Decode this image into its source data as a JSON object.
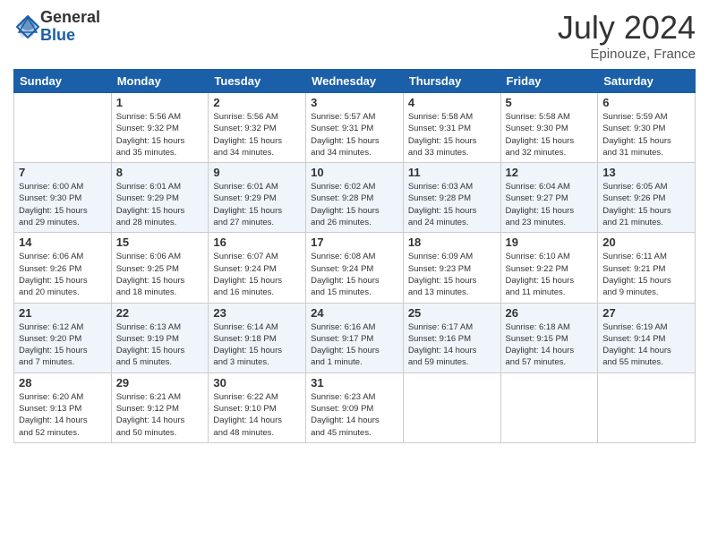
{
  "header": {
    "logo_general": "General",
    "logo_blue": "Blue",
    "month": "July 2024",
    "location": "Epinouze, France"
  },
  "weekdays": [
    "Sunday",
    "Monday",
    "Tuesday",
    "Wednesday",
    "Thursday",
    "Friday",
    "Saturday"
  ],
  "weeks": [
    [
      {
        "day": "",
        "info": ""
      },
      {
        "day": "1",
        "info": "Sunrise: 5:56 AM\nSunset: 9:32 PM\nDaylight: 15 hours\nand 35 minutes."
      },
      {
        "day": "2",
        "info": "Sunrise: 5:56 AM\nSunset: 9:32 PM\nDaylight: 15 hours\nand 34 minutes."
      },
      {
        "day": "3",
        "info": "Sunrise: 5:57 AM\nSunset: 9:31 PM\nDaylight: 15 hours\nand 34 minutes."
      },
      {
        "day": "4",
        "info": "Sunrise: 5:58 AM\nSunset: 9:31 PM\nDaylight: 15 hours\nand 33 minutes."
      },
      {
        "day": "5",
        "info": "Sunrise: 5:58 AM\nSunset: 9:30 PM\nDaylight: 15 hours\nand 32 minutes."
      },
      {
        "day": "6",
        "info": "Sunrise: 5:59 AM\nSunset: 9:30 PM\nDaylight: 15 hours\nand 31 minutes."
      }
    ],
    [
      {
        "day": "7",
        "info": "Sunrise: 6:00 AM\nSunset: 9:30 PM\nDaylight: 15 hours\nand 29 minutes."
      },
      {
        "day": "8",
        "info": "Sunrise: 6:01 AM\nSunset: 9:29 PM\nDaylight: 15 hours\nand 28 minutes."
      },
      {
        "day": "9",
        "info": "Sunrise: 6:01 AM\nSunset: 9:29 PM\nDaylight: 15 hours\nand 27 minutes."
      },
      {
        "day": "10",
        "info": "Sunrise: 6:02 AM\nSunset: 9:28 PM\nDaylight: 15 hours\nand 26 minutes."
      },
      {
        "day": "11",
        "info": "Sunrise: 6:03 AM\nSunset: 9:28 PM\nDaylight: 15 hours\nand 24 minutes."
      },
      {
        "day": "12",
        "info": "Sunrise: 6:04 AM\nSunset: 9:27 PM\nDaylight: 15 hours\nand 23 minutes."
      },
      {
        "day": "13",
        "info": "Sunrise: 6:05 AM\nSunset: 9:26 PM\nDaylight: 15 hours\nand 21 minutes."
      }
    ],
    [
      {
        "day": "14",
        "info": "Sunrise: 6:06 AM\nSunset: 9:26 PM\nDaylight: 15 hours\nand 20 minutes."
      },
      {
        "day": "15",
        "info": "Sunrise: 6:06 AM\nSunset: 9:25 PM\nDaylight: 15 hours\nand 18 minutes."
      },
      {
        "day": "16",
        "info": "Sunrise: 6:07 AM\nSunset: 9:24 PM\nDaylight: 15 hours\nand 16 minutes."
      },
      {
        "day": "17",
        "info": "Sunrise: 6:08 AM\nSunset: 9:24 PM\nDaylight: 15 hours\nand 15 minutes."
      },
      {
        "day": "18",
        "info": "Sunrise: 6:09 AM\nSunset: 9:23 PM\nDaylight: 15 hours\nand 13 minutes."
      },
      {
        "day": "19",
        "info": "Sunrise: 6:10 AM\nSunset: 9:22 PM\nDaylight: 15 hours\nand 11 minutes."
      },
      {
        "day": "20",
        "info": "Sunrise: 6:11 AM\nSunset: 9:21 PM\nDaylight: 15 hours\nand 9 minutes."
      }
    ],
    [
      {
        "day": "21",
        "info": "Sunrise: 6:12 AM\nSunset: 9:20 PM\nDaylight: 15 hours\nand 7 minutes."
      },
      {
        "day": "22",
        "info": "Sunrise: 6:13 AM\nSunset: 9:19 PM\nDaylight: 15 hours\nand 5 minutes."
      },
      {
        "day": "23",
        "info": "Sunrise: 6:14 AM\nSunset: 9:18 PM\nDaylight: 15 hours\nand 3 minutes."
      },
      {
        "day": "24",
        "info": "Sunrise: 6:16 AM\nSunset: 9:17 PM\nDaylight: 15 hours\nand 1 minute."
      },
      {
        "day": "25",
        "info": "Sunrise: 6:17 AM\nSunset: 9:16 PM\nDaylight: 14 hours\nand 59 minutes."
      },
      {
        "day": "26",
        "info": "Sunrise: 6:18 AM\nSunset: 9:15 PM\nDaylight: 14 hours\nand 57 minutes."
      },
      {
        "day": "27",
        "info": "Sunrise: 6:19 AM\nSunset: 9:14 PM\nDaylight: 14 hours\nand 55 minutes."
      }
    ],
    [
      {
        "day": "28",
        "info": "Sunrise: 6:20 AM\nSunset: 9:13 PM\nDaylight: 14 hours\nand 52 minutes."
      },
      {
        "day": "29",
        "info": "Sunrise: 6:21 AM\nSunset: 9:12 PM\nDaylight: 14 hours\nand 50 minutes."
      },
      {
        "day": "30",
        "info": "Sunrise: 6:22 AM\nSunset: 9:10 PM\nDaylight: 14 hours\nand 48 minutes."
      },
      {
        "day": "31",
        "info": "Sunrise: 6:23 AM\nSunset: 9:09 PM\nDaylight: 14 hours\nand 45 minutes."
      },
      {
        "day": "",
        "info": ""
      },
      {
        "day": "",
        "info": ""
      },
      {
        "day": "",
        "info": ""
      }
    ]
  ]
}
